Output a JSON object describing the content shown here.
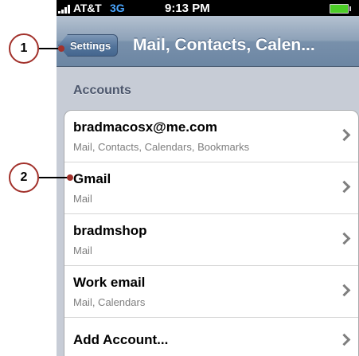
{
  "status_bar": {
    "carrier": "AT&T",
    "network": "3G",
    "time": "9:13 PM"
  },
  "nav_bar": {
    "back_label": "Settings",
    "title": "Mail, Contacts, Calen..."
  },
  "accounts": {
    "heading": "Accounts",
    "rows": [
      {
        "title": "bradmacosx@me.com",
        "subtitle": "Mail, Contacts, Calendars, Bookmarks"
      },
      {
        "title": "Gmail",
        "subtitle": "Mail"
      },
      {
        "title": "bradmshop",
        "subtitle": "Mail"
      },
      {
        "title": "Work email",
        "subtitle": "Mail, Calendars"
      },
      {
        "title": "Add Account..."
      }
    ]
  },
  "callouts": {
    "one": "1",
    "two": "2"
  },
  "colors": {
    "callout_accent": "#a2312b",
    "network_label": "#4aa6ff",
    "battery": "#4ccd27"
  }
}
